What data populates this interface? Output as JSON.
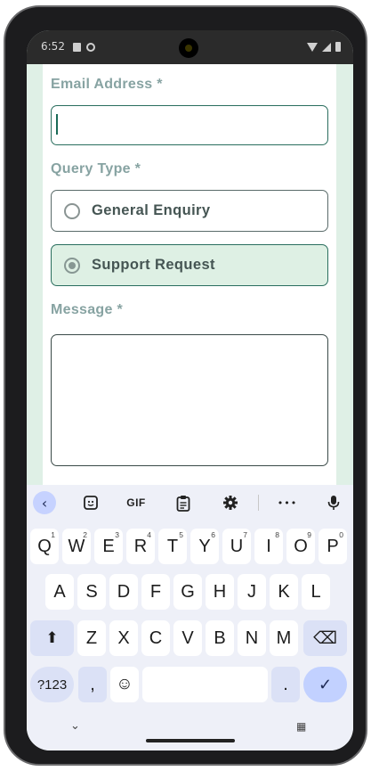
{
  "status": {
    "time": "6:52"
  },
  "form": {
    "email_label": "Email Address *",
    "email_value": "",
    "query_label": "Query Type *",
    "options": [
      {
        "label": "General Enquiry",
        "selected": false
      },
      {
        "label": "Support Request",
        "selected": true
      }
    ],
    "message_label": "Message *",
    "message_value": ""
  },
  "keyboard": {
    "toolbar": {
      "gif_label": "GIF",
      "more_label": "•••"
    },
    "row1": [
      {
        "key": "Q",
        "hint": "1"
      },
      {
        "key": "W",
        "hint": "2"
      },
      {
        "key": "E",
        "hint": "3"
      },
      {
        "key": "R",
        "hint": "4"
      },
      {
        "key": "T",
        "hint": "5"
      },
      {
        "key": "Y",
        "hint": "6"
      },
      {
        "key": "U",
        "hint": "7"
      },
      {
        "key": "I",
        "hint": "8"
      },
      {
        "key": "O",
        "hint": "9"
      },
      {
        "key": "P",
        "hint": "0"
      }
    ],
    "row2": [
      "A",
      "S",
      "D",
      "F",
      "G",
      "H",
      "J",
      "K",
      "L"
    ],
    "row3": [
      "Z",
      "X",
      "C",
      "V",
      "B",
      "N",
      "M"
    ],
    "symbols_label": "?123",
    "comma_label": ",",
    "period_label": ".",
    "emoji_label": "☺",
    "enter_label": "✓",
    "shift_label": "⬆",
    "backspace_label": "⌫"
  },
  "colors": {
    "accent": "#2a6e5e",
    "label": "#87a3a2",
    "selected_bg": "#def0e4",
    "page_bg": "#dff0e6"
  }
}
